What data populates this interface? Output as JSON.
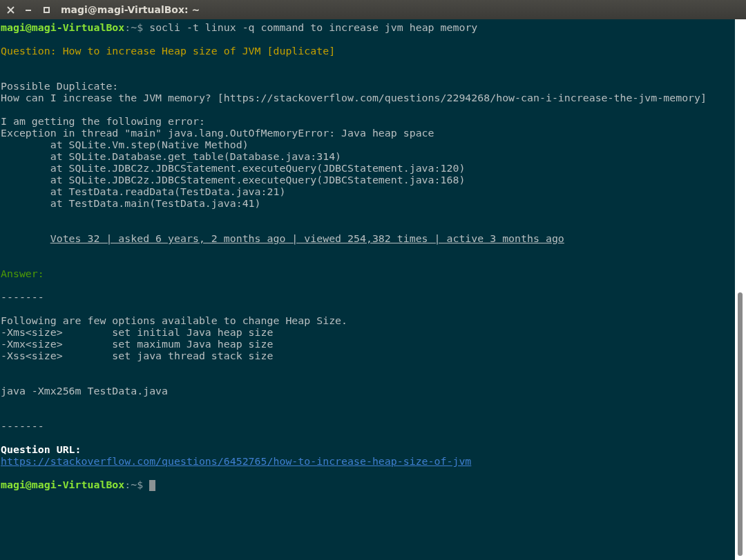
{
  "window": {
    "title": "magi@magi-VirtualBox: ~"
  },
  "terminal": {
    "lines": [
      {
        "kind": "prompt",
        "user": "magi@magi-VirtualBox",
        "path": ":~$",
        "command": "socli -t linux -q command to increase jvm heap memory",
        "cursor": false
      },
      {
        "kind": "blank"
      },
      {
        "kind": "question",
        "text": "Question: How to increase Heap size of JVM [duplicate]"
      },
      {
        "kind": "blank"
      },
      {
        "kind": "blank"
      },
      {
        "kind": "plain",
        "text": "Possible Duplicate:"
      },
      {
        "kind": "plain",
        "text": "How can I increase the JVM memory? [https://stackoverflow.com/questions/2294268/how-can-i-increase-the-jvm-memory]"
      },
      {
        "kind": "blank"
      },
      {
        "kind": "plain",
        "text": "I am getting the following error:"
      },
      {
        "kind": "plain",
        "text": "Exception in thread \"main\" java.lang.OutOfMemoryError: Java heap space"
      },
      {
        "kind": "plain",
        "text": "        at SQLite.Vm.step(Native Method)"
      },
      {
        "kind": "plain",
        "text": "        at SQLite.Database.get_table(Database.java:314)"
      },
      {
        "kind": "plain",
        "text": "        at SQLite.JDBC2z.JDBCStatement.executeQuery(JDBCStatement.java:120)"
      },
      {
        "kind": "plain",
        "text": "        at SQLite.JDBC2z.JDBCStatement.executeQuery(JDBCStatement.java:168)"
      },
      {
        "kind": "plain",
        "text": "        at TestData.readData(TestData.java:21)"
      },
      {
        "kind": "plain",
        "text": "        at TestData.main(TestData.java:41)"
      },
      {
        "kind": "blank"
      },
      {
        "kind": "blank"
      },
      {
        "kind": "meta",
        "text": "Votes 32 | asked 6 years, 2 months ago | viewed 254,382 times | active 3 months ago"
      },
      {
        "kind": "blank"
      },
      {
        "kind": "blank"
      },
      {
        "kind": "answer",
        "text": "Answer:"
      },
      {
        "kind": "blank"
      },
      {
        "kind": "plain",
        "text": "-------"
      },
      {
        "kind": "blank"
      },
      {
        "kind": "plain",
        "text": "Following are few options available to change Heap Size."
      },
      {
        "kind": "plain",
        "text": "-Xms<size>        set initial Java heap size"
      },
      {
        "kind": "plain",
        "text": "-Xmx<size>        set maximum Java heap size"
      },
      {
        "kind": "plain",
        "text": "-Xss<size>        set java thread stack size"
      },
      {
        "kind": "blank"
      },
      {
        "kind": "blank"
      },
      {
        "kind": "plain",
        "text": "java -Xmx256m TestData.java"
      },
      {
        "kind": "blank"
      },
      {
        "kind": "blank"
      },
      {
        "kind": "plain",
        "text": "-------"
      },
      {
        "kind": "blank"
      },
      {
        "kind": "heading",
        "text": "Question URL:"
      },
      {
        "kind": "link",
        "text": "https://stackoverflow.com/questions/6452765/how-to-increase-heap-size-of-jvm"
      },
      {
        "kind": "blank"
      },
      {
        "kind": "prompt",
        "user": "magi@magi-VirtualBox",
        "path": ":~$",
        "cursor": true
      }
    ]
  }
}
